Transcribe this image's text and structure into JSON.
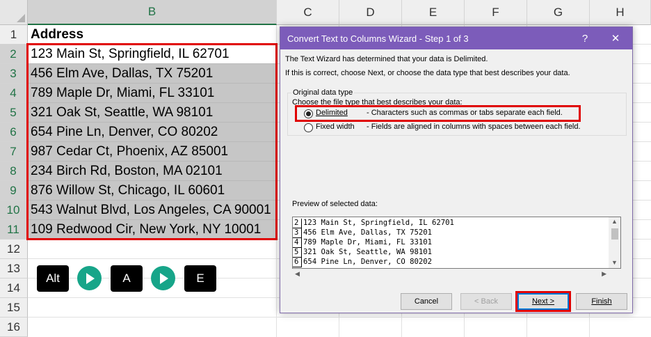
{
  "spreadsheet": {
    "columns": [
      "B",
      "C",
      "D",
      "E",
      "F",
      "G",
      "H"
    ],
    "rows": [
      "1",
      "2",
      "3",
      "4",
      "5",
      "6",
      "7",
      "8",
      "9",
      "10",
      "11",
      "12",
      "13",
      "14",
      "15",
      "16"
    ],
    "header_cell": "Address",
    "addresses": [
      "123 Main St, Springfield, IL 62701",
      "456 Elm Ave, Dallas, TX 75201",
      "789 Maple Dr, Miami, FL 33101",
      "321 Oak St, Seattle, WA 98101",
      "654 Pine Ln, Denver, CO 80202",
      "987 Cedar Ct, Phoenix, AZ 85001",
      "234 Birch Rd, Boston, MA 02101",
      "876 Willow St, Chicago, IL 60601",
      "543 Walnut Blvd, Los Angeles, CA 90001",
      "109 Redwood Cir, New York, NY 10001"
    ]
  },
  "shortcut": {
    "keys": [
      "Alt",
      "A",
      "E"
    ]
  },
  "dialog": {
    "title": "Convert Text to Columns Wizard - Step 1 of 3",
    "help_glyph": "?",
    "close_glyph": "✕",
    "intro_line1": "The Text Wizard has determined that your data is Delimited.",
    "intro_line2": "If this is correct, choose Next, or choose the data type that best describes your data.",
    "group_label": "Original data type",
    "choose_label": "Choose the file type that best describes your data:",
    "options": [
      {
        "label": "Delimited",
        "description": "- Characters such as commas or tabs separate each field.",
        "selected": true
      },
      {
        "label": "Fixed width",
        "description": "- Fields are aligned in columns with spaces between each field.",
        "selected": false
      }
    ],
    "preview_label": "Preview of selected data:",
    "preview_lines": [
      {
        "num": "2",
        "text": "123 Main St, Springfield, IL 62701"
      },
      {
        "num": "3",
        "text": "456 Elm Ave, Dallas, TX 75201"
      },
      {
        "num": "4",
        "text": "789 Maple Dr, Miami, FL 33101"
      },
      {
        "num": "5",
        "text": "321 Oak St, Seattle, WA 98101"
      },
      {
        "num": "6",
        "text": "654 Pine Ln, Denver, CO 80202"
      }
    ],
    "buttons": {
      "cancel": "Cancel",
      "back": "< Back",
      "next": "Next >",
      "finish": "Finish"
    }
  },
  "colors": {
    "titlebar": "#7c5cba",
    "highlight_red": "#e00000",
    "excel_green": "#217346",
    "play_teal": "#17a589"
  }
}
